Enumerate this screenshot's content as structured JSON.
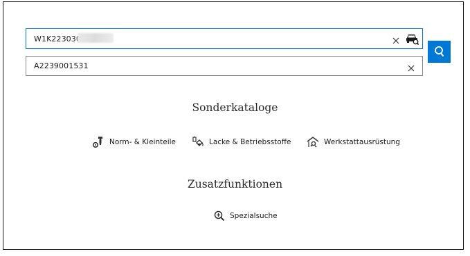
{
  "vin_field": {
    "value": "W1K223030",
    "clear_label": "×",
    "icon": "car-search-icon"
  },
  "part_field": {
    "value": "A2239001531",
    "clear_label": "×"
  },
  "search_button": {
    "icon": "search-icon"
  },
  "sections": {
    "sonderkataloge": {
      "title": "Sonderkataloge",
      "items": [
        {
          "label": "Norm- & Kleinteile",
          "icon": "bolt-gear-icon"
        },
        {
          "label": "Lacke & Betriebsstoffe",
          "icon": "paint-bucket-icon"
        },
        {
          "label": "Werkstattausrüstung",
          "icon": "garage-wrench-icon"
        }
      ]
    },
    "zusatzfunktionen": {
      "title": "Zusatzfunktionen",
      "items": [
        {
          "label": "Spezialsuche",
          "icon": "zoom-plus-icon"
        }
      ]
    }
  },
  "colors": {
    "accent": "#0078d6",
    "border": "#8a8a8a"
  }
}
